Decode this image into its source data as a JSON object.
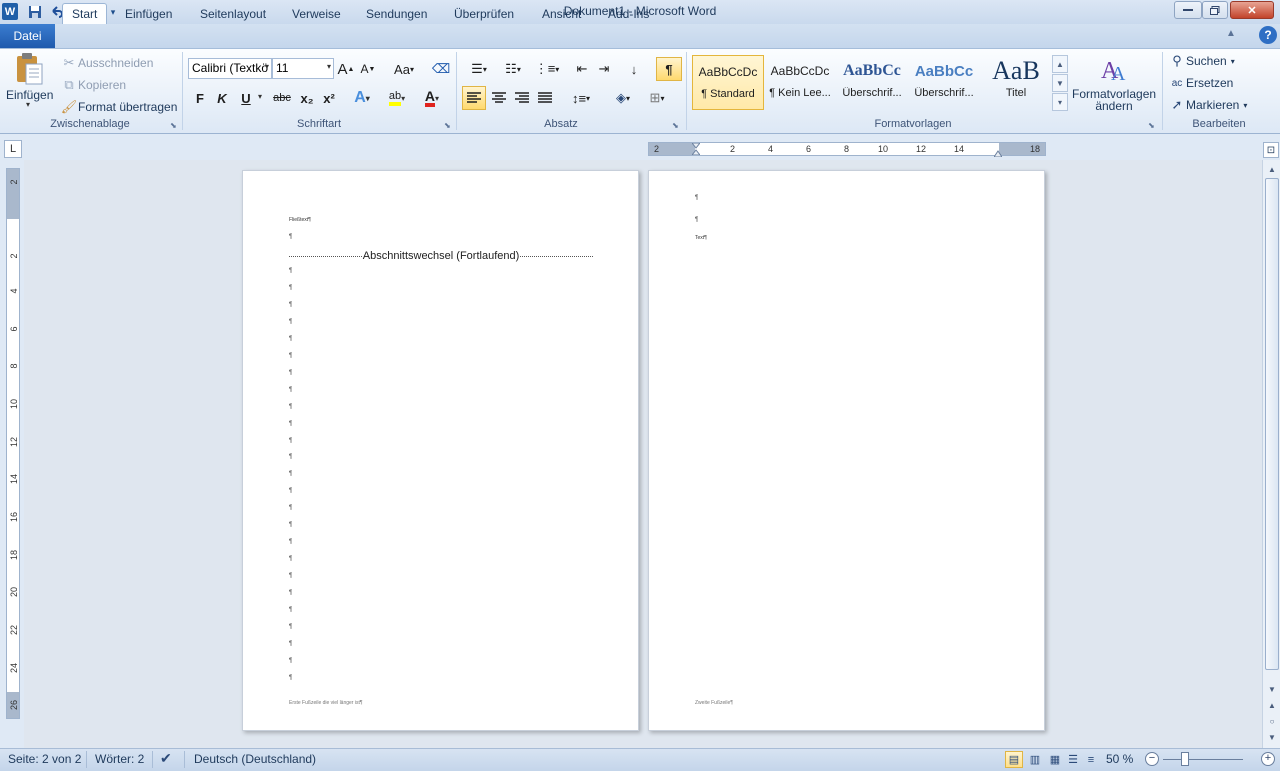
{
  "window": {
    "title": "Dokument1  -  Microsoft Word",
    "minimize_icon": "minimize-icon",
    "maximize_icon": "restore-icon",
    "close_icon": "close-icon"
  },
  "quick_access": {
    "app_icon_letter": "W",
    "icons": [
      "save-icon",
      "undo-icon",
      "redo-icon",
      "customize-icon"
    ]
  },
  "tabs": [
    {
      "label": "Datei",
      "active": false
    },
    {
      "label": "Start",
      "active": true
    },
    {
      "label": "Einfügen",
      "active": false
    },
    {
      "label": "Seitenlayout",
      "active": false
    },
    {
      "label": "Verweise",
      "active": false
    },
    {
      "label": "Sendungen",
      "active": false
    },
    {
      "label": "Überprüfen",
      "active": false
    },
    {
      "label": "Ansicht",
      "active": false
    },
    {
      "label": "Add-Ins",
      "active": false
    }
  ],
  "ribbon": {
    "clipboard": {
      "label": "Zwischenablage",
      "paste": "Einfügen",
      "cut": "Ausschneiden",
      "copy": "Kopieren",
      "format_painter": "Format übertragen"
    },
    "font": {
      "label": "Schriftart",
      "font_name": "Calibri (Textkö",
      "font_size": "11",
      "grow": "A",
      "shrink": "A",
      "change_case": "Aa",
      "bold": "F",
      "italic": "K",
      "underline": "U",
      "strike": "abc",
      "subscript": "x₂",
      "superscript": "x²",
      "text_effects": "A",
      "highlight": "ab",
      "font_color": "A"
    },
    "paragraph": {
      "label": "Absatz",
      "show_marks": "¶"
    },
    "styles": {
      "label": "Formatvorlagen",
      "items": [
        {
          "sample": "AaBbCcDc",
          "name": "¶ Standard"
        },
        {
          "sample": "AaBbCcDc",
          "name": "¶ Kein Lee..."
        },
        {
          "sample": "AaBbCc",
          "name": "Überschrif..."
        },
        {
          "sample": "AaBbCc",
          "name": "Überschrif..."
        },
        {
          "sample": "AaB",
          "name": "Titel"
        }
      ],
      "change_styles": "Formatvorlagen ändern"
    },
    "editing": {
      "label": "Bearbeiten",
      "find": "Suchen",
      "replace": "Ersetzen",
      "select": "Markieren"
    }
  },
  "ruler": {
    "h_ticks": [
      "2",
      "2",
      "4",
      "6",
      "8",
      "10",
      "12",
      "14",
      "18"
    ],
    "v_ticks": [
      "2",
      "2",
      "4",
      "6",
      "8",
      "10",
      "12",
      "14",
      "16",
      "18",
      "20",
      "22",
      "24",
      "26"
    ]
  },
  "document": {
    "page1": {
      "first_line": "Fließtext¶",
      "section_break": "Abschnittswechsel (Fortlaufend)",
      "pilcrow": "¶",
      "footer": "Erste Fußzeile die viel länger ist¶"
    },
    "page2": {
      "pilcrow": "¶",
      "text_line": "Text¶",
      "footer": "Zweite Fußzeile¶"
    }
  },
  "status": {
    "page": "Seite: 2 von 2",
    "words": "Wörter: 2",
    "language": "Deutsch (Deutschland)",
    "zoom": "50 %"
  }
}
